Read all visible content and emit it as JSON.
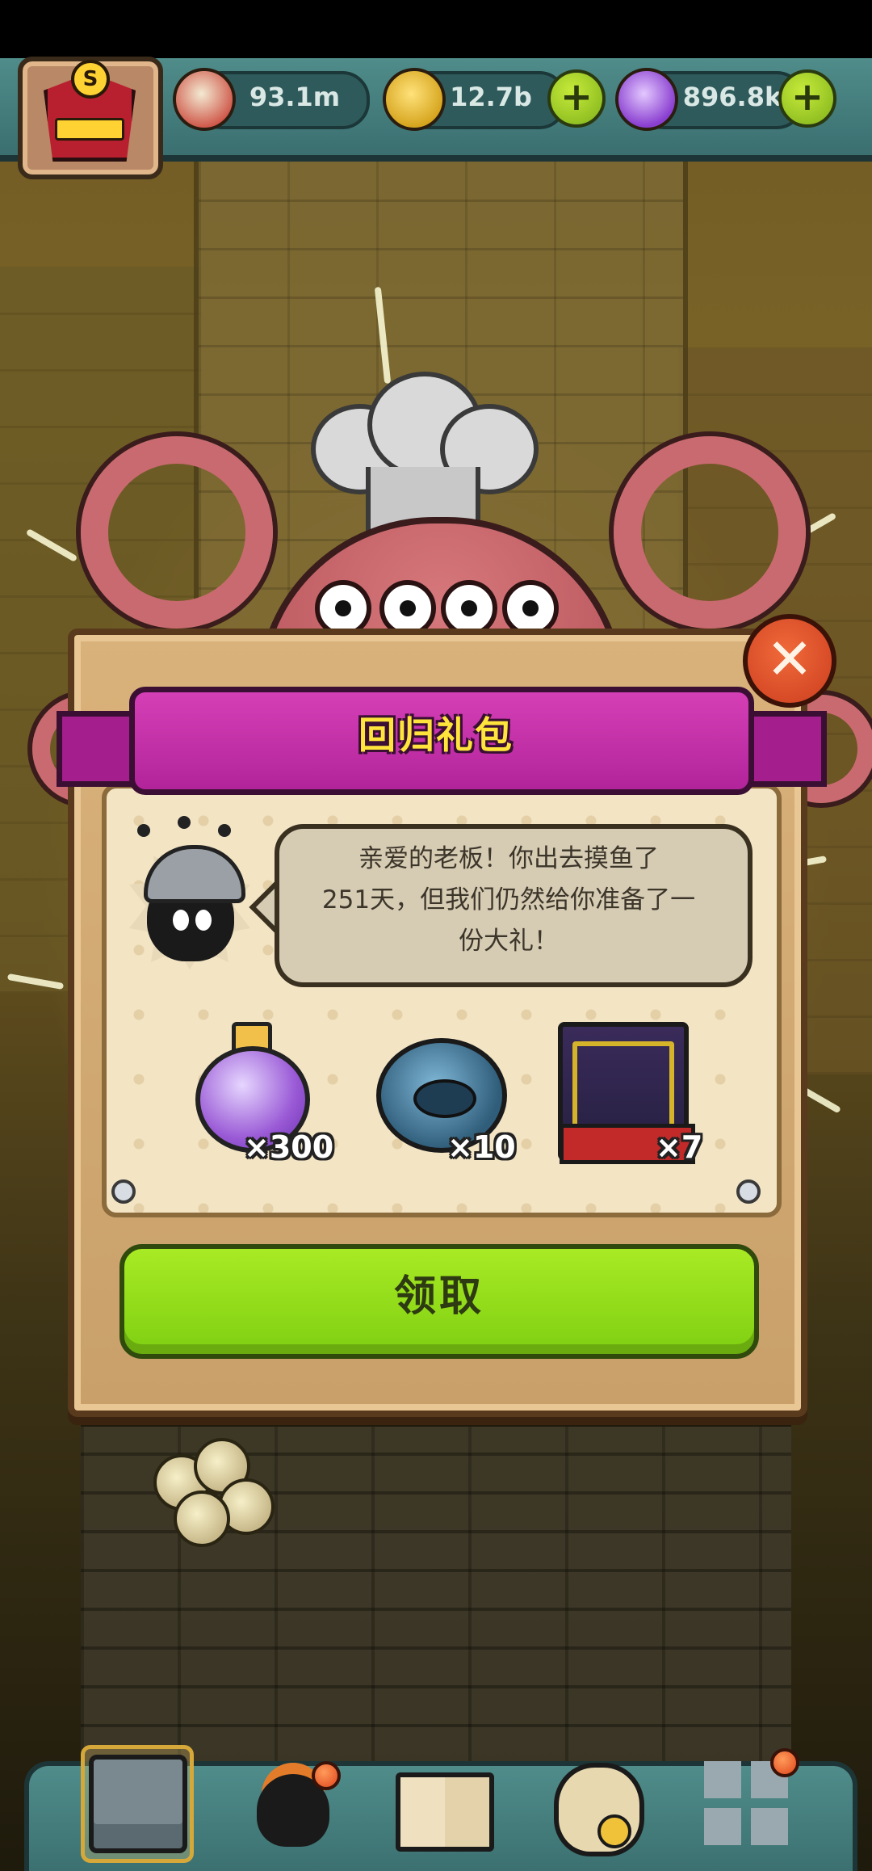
{
  "resources": {
    "eyeballs": "93.1m",
    "coins": "12.7b",
    "potions": "896.8k"
  },
  "icons": {
    "eyeball": "eyeball-icon",
    "coin": "coin-icon",
    "potion": "potion-icon",
    "plus": "plus-icon",
    "close": "close-icon"
  },
  "avatar": {
    "badge": "S"
  },
  "dialog": {
    "title": "回归礼包",
    "message_line1": "亲爱的老板！你出去摸鱼了",
    "message_line2": "251天，但我们仍然给你准备了一",
    "message_line3": "份大礼！",
    "close_symbol": "✕",
    "rewards": [
      {
        "name": "potion",
        "count": "×300"
      },
      {
        "name": "relic-disc",
        "count": "×10"
      },
      {
        "name": "relic-painting",
        "count": "×7"
      }
    ],
    "claim_label": "领取"
  },
  "bottom_nav": {
    "items": [
      "kitchen",
      "monsters",
      "recipe-book",
      "shop-bag",
      "more"
    ]
  },
  "colors": {
    "accent_green": "#8fd81a",
    "banner_magenta": "#c22fa8",
    "title_yellow": "#ffe53b",
    "close_orange": "#e0522a"
  }
}
